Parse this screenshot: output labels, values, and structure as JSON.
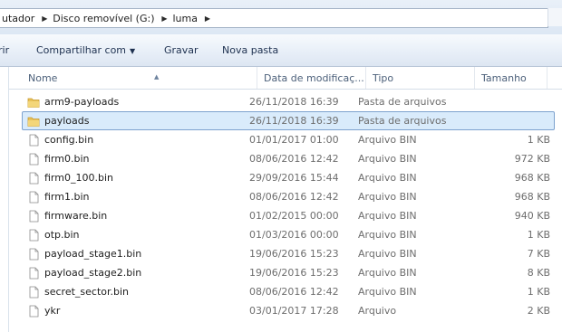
{
  "window": {
    "breadcrumb": [
      "utador",
      "Disco removível (G:)",
      "luma"
    ]
  },
  "toolbar": {
    "partial_label": "rir",
    "share_label": "Compartilhar com",
    "burn_label": "Gravar",
    "new_folder_label": "Nova pasta"
  },
  "columns": {
    "name": "Nome",
    "date": "Data de modificaç...",
    "type": "Tipo",
    "size": "Tamanho"
  },
  "files": [
    {
      "name": "arm9-payloads",
      "date": "26/11/2018 16:39",
      "type": "Pasta de arquivos",
      "size": "",
      "icon": "folder-icon",
      "selected": false
    },
    {
      "name": "payloads",
      "date": "26/11/2018 16:39",
      "type": "Pasta de arquivos",
      "size": "",
      "icon": "folder-icon",
      "selected": true
    },
    {
      "name": "config.bin",
      "date": "01/01/2017 01:00",
      "type": "Arquivo BIN",
      "size": "1 KB",
      "icon": "file-icon",
      "selected": false
    },
    {
      "name": "firm0.bin",
      "date": "08/06/2016 12:42",
      "type": "Arquivo BIN",
      "size": "972 KB",
      "icon": "file-icon",
      "selected": false
    },
    {
      "name": "firm0_100.bin",
      "date": "29/09/2016 15:44",
      "type": "Arquivo BIN",
      "size": "968 KB",
      "icon": "file-icon",
      "selected": false
    },
    {
      "name": "firm1.bin",
      "date": "08/06/2016 12:42",
      "type": "Arquivo BIN",
      "size": "968 KB",
      "icon": "file-icon",
      "selected": false
    },
    {
      "name": "firmware.bin",
      "date": "01/02/2015 00:00",
      "type": "Arquivo BIN",
      "size": "940 KB",
      "icon": "file-icon",
      "selected": false
    },
    {
      "name": "otp.bin",
      "date": "01/03/2016 00:00",
      "type": "Arquivo BIN",
      "size": "1 KB",
      "icon": "file-icon",
      "selected": false
    },
    {
      "name": "payload_stage1.bin",
      "date": "19/06/2016 15:23",
      "type": "Arquivo BIN",
      "size": "7 KB",
      "icon": "file-icon",
      "selected": false
    },
    {
      "name": "payload_stage2.bin",
      "date": "19/06/2016 15:23",
      "type": "Arquivo BIN",
      "size": "8 KB",
      "icon": "file-icon",
      "selected": false
    },
    {
      "name": "secret_sector.bin",
      "date": "08/06/2016 12:42",
      "type": "Arquivo BIN",
      "size": "1 KB",
      "icon": "file-icon",
      "selected": false
    },
    {
      "name": "ykr",
      "date": "03/01/2017 17:28",
      "type": "Arquivo",
      "size": "2 KB",
      "icon": "file-icon",
      "selected": false
    }
  ],
  "colors": {
    "selection_bg": "#d9ebfb",
    "selection_border": "#7da2ce",
    "folder_yellow": "#e8c25a"
  }
}
